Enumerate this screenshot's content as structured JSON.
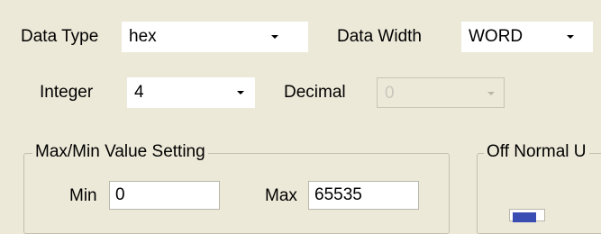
{
  "data_type": {
    "label": "Data Type",
    "value": "hex"
  },
  "data_width": {
    "label": "Data Width",
    "value": "WORD"
  },
  "integer": {
    "label": "Integer",
    "value": "4"
  },
  "decimal": {
    "label": "Decimal",
    "value": "0"
  },
  "max_min_group": {
    "legend": "Max/Min Value Setting",
    "min_label": "Min",
    "min_value": "0",
    "max_label": "Max",
    "max_value": "65535"
  },
  "off_normal_group": {
    "legend": "Off Normal U"
  },
  "colors": {
    "dialog_bg": "#ece9d8",
    "field_bg": "#ffffff",
    "swatch": "#3a4db2"
  }
}
